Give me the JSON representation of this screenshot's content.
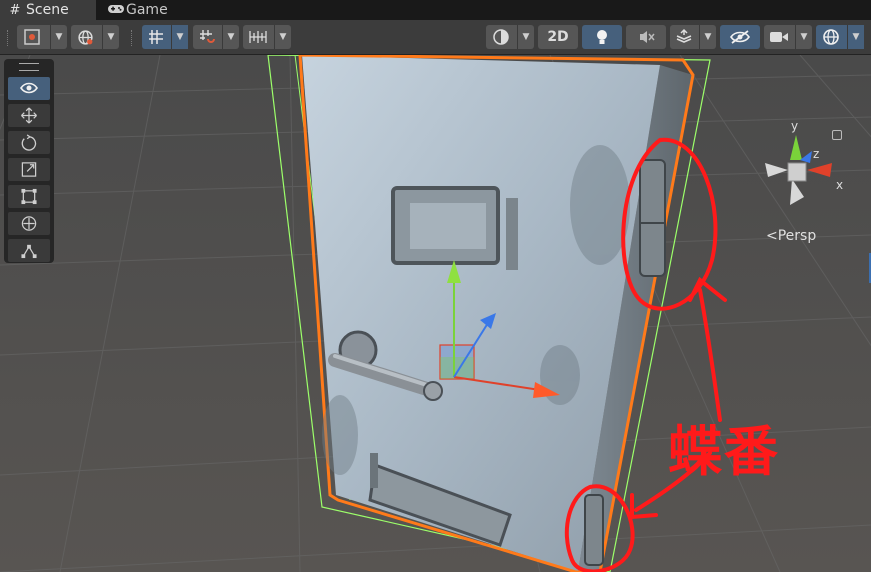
{
  "tabs": [
    {
      "label": "Scene",
      "icon": "grid-hash-icon"
    },
    {
      "label": "Game",
      "icon": "gamepad-icon"
    }
  ],
  "toolbar": {
    "toggle_2d_label": "2D"
  },
  "viewport": {
    "persp_label": "Persp",
    "axis_x": "x",
    "axis_y": "y",
    "axis_z": "z"
  },
  "annotation": {
    "text": "蝶番",
    "color": "#ff1a1a"
  },
  "colors": {
    "selection_outline": "#ff7a1a",
    "bounds_outline": "#9cff6a",
    "active_button": "#46607c",
    "axis_x": "#e0412a",
    "axis_y": "#7ad33a",
    "axis_z": "#3a78e8"
  }
}
